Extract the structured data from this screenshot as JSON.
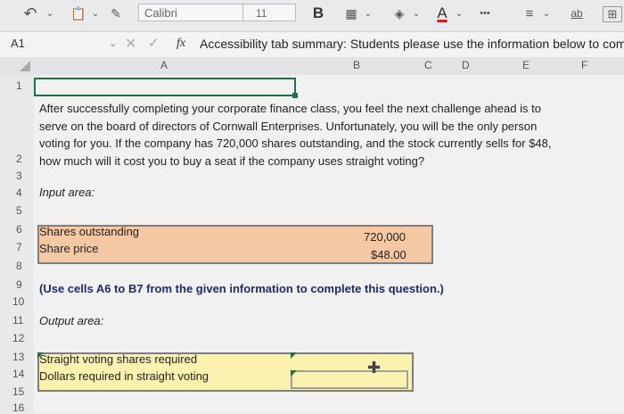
{
  "toolbar": {
    "font_name": "Calibri",
    "font_size": "11",
    "bold_label": "B",
    "font_color_label": "A",
    "more_label": "•••",
    "wrap_label": "ab"
  },
  "formula_bar": {
    "name_box": "A1",
    "fx_label": "fx",
    "content": "Accessibility tab summary: Students please use the information below to com"
  },
  "columns": [
    "A",
    "B",
    "C",
    "D",
    "E",
    "F"
  ],
  "rows": [
    "1",
    "2",
    "3",
    "4",
    "5",
    "6",
    "7",
    "8",
    "9",
    "10",
    "11",
    "12",
    "13",
    "14",
    "15",
    "16"
  ],
  "cells": {
    "question": "After successfully completing your corporate finance class, you feel the next challenge ahead is to serve on the board of directors of Cornwall Enterprises. Unfortunately, you will be the only person voting for you. If the company has 720,000 shares outstanding, and the stock currently sells for $48, how much will it cost you to buy a seat if the company uses straight voting?",
    "input_area": "Input area:",
    "shares_label": "Shares outstanding",
    "shares_value": "720,000",
    "price_label": "Share price",
    "price_value": "$48.00",
    "instruction": "(Use cells A6 to B7 from the given information to complete this question.)",
    "output_area": "Output area:",
    "straight_shares_label": "Straight voting shares required",
    "dollars_label": "Dollars required in straight voting"
  }
}
